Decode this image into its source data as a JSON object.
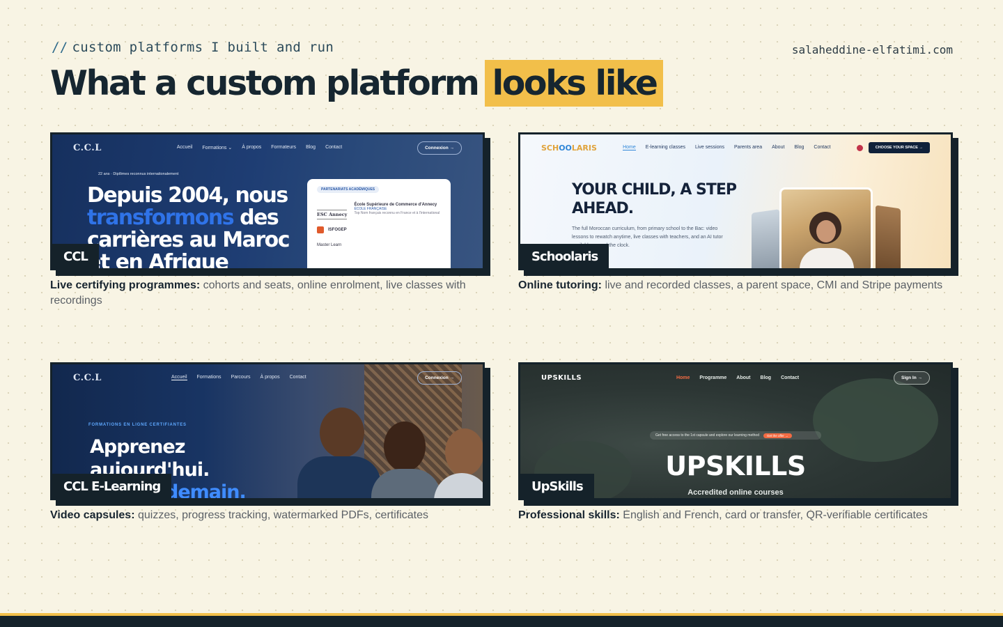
{
  "kicker": {
    "slashes": "//",
    "text": "custom platforms I built and run"
  },
  "site": "salaheddine-elfatimi.com",
  "title": {
    "main": "What a custom platform",
    "highlight": "looks like"
  },
  "colors": {
    "background": "#f8f4e4",
    "accent": "#f2bf4a",
    "dark": "#15222a"
  },
  "cards": [
    {
      "label": "CCL",
      "caption_bold": "Live certifying programmes:",
      "caption_rest": "cohorts and seats, online enrolment, live classes with recordings",
      "shot": {
        "logo": "C.C.L",
        "nav": [
          "Accueil",
          "Formations ⌄",
          "À propos",
          "Formateurs",
          "Blog",
          "Contact"
        ],
        "cta": "Connexion →",
        "tag": "22 ans · Diplômes reconnus internationalement",
        "hero_1": "Depuis 2004, nous",
        "hero_blue": "transformons",
        "hero_2": "des carrières au Maroc et en Afrique",
        "panel_pill": "PARTENARIATS ACADÉMIQUES",
        "panel_school": "École Supérieure de Commerce d'Annecy",
        "panel_school_sub": "ÉCOLE FRANÇAISE",
        "panel_desc": "Top Nom français reconnu en France et à l'international",
        "panel_esc": "ESC Annecy",
        "panel_logos": "ISFOGEP",
        "panel_bottom": "Master Learn"
      }
    },
    {
      "label": "Schoolaris",
      "caption_bold": "Online tutoring:",
      "caption_rest": "live and recorded classes, a parent space, CMI and Stripe payments",
      "shot": {
        "logo_a": "SCH",
        "logo_b": "OO",
        "logo_c": "LARIS",
        "nav": [
          "Home",
          "E-learning classes",
          "Live sessions",
          "Parents area",
          "About",
          "Blog",
          "Contact"
        ],
        "cta": "CHOOSE YOUR SPACE →",
        "headline": "YOUR CHILD, A STEP AHEAD.",
        "sub": "The full Moroccan curriculum, from primary school to the Bac: video lessons to rewatch anytime, live classes with teachers, and an AI tutor available around the clock."
      }
    },
    {
      "label": "CCL E-Learning",
      "caption_bold": "Video capsules:",
      "caption_rest": "quizzes, progress tracking, watermarked PDFs, certificates",
      "shot": {
        "logo": "C.C.L",
        "nav": [
          "Accueil",
          "Formations",
          "Parcours",
          "À propos",
          "Contact"
        ],
        "cta": "Connexion →",
        "tag": "FORMATIONS EN LIGNE CERTIFIANTES",
        "hero_1": "Apprenez",
        "hero_2": "aujourd'hui.",
        "hero_blue": "demain."
      }
    },
    {
      "label": "UpSkills",
      "caption_bold": "Professional skills:",
      "caption_rest": "English and French, card or transfer, QR-verifiable certificates",
      "shot": {
        "logo": "UPSKILLS",
        "nav": [
          "Home",
          "Programme",
          "About",
          "Blog",
          "Contact"
        ],
        "cta": "Sign In →",
        "promo": "Get free access to the 1st capsule and explore our learning method",
        "promo_btn": "Get the offer →",
        "big": "UPSKILLS",
        "accredited": "Accredited online courses"
      }
    }
  ]
}
